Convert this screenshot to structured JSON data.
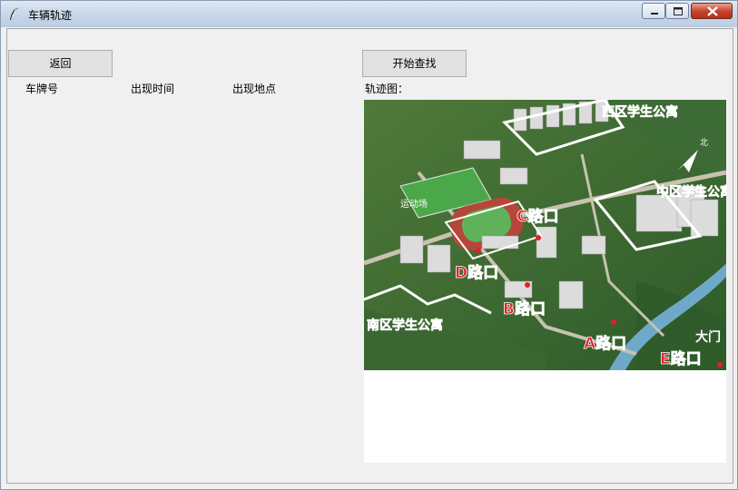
{
  "window": {
    "title": "车辆轨迹"
  },
  "buttons": {
    "back": "返回",
    "start": "开始查找"
  },
  "columns": {
    "plate": "车牌号",
    "time": "出现时间",
    "location": "出现地点"
  },
  "map": {
    "label": "轨迹图：",
    "areas": {
      "west": "西区学生公寓",
      "middle": "中区学生公寓",
      "south": "南区学生公寓"
    },
    "gates": {
      "a": "A路口",
      "b": "B路口",
      "c": "C路口",
      "d": "D路口",
      "e": "E路口"
    },
    "places": {
      "field": "运动场",
      "main_gate": "大门"
    },
    "north": "北"
  },
  "colors": {
    "window_bg": "#f0f0f0",
    "button_bg": "#e1e1e1",
    "gate_red": "#e0202a",
    "area_orange": "#ff7a10"
  }
}
